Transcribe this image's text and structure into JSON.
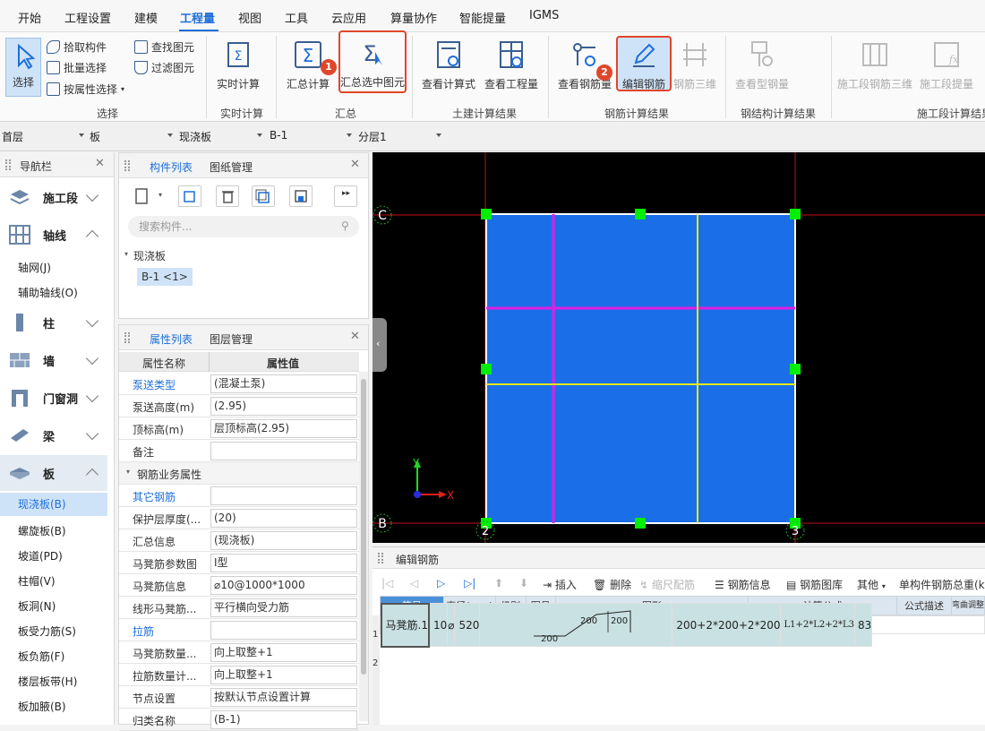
{
  "menu": [
    "开始",
    "工程设置",
    "建模",
    "工程量",
    "视图",
    "工具",
    "云应用",
    "算量协作",
    "智能提量",
    "IGMS"
  ],
  "ribbon": {
    "select_group": {
      "select": "选择",
      "pick": "拾取构件",
      "batch": "批量选择",
      "by_attr": "按属性选择",
      "find": "查找图元",
      "filter": "过滤图元",
      "label": "选择"
    },
    "realtime": {
      "btn": "实时计算",
      "label": "实时计算"
    },
    "summary": {
      "calc": "汇总计算",
      "calc_selected": "汇总选中图元",
      "label": "汇总"
    },
    "civil": {
      "formula": "查看计算式",
      "quantity": "查看工程量",
      "label": "土建计算结果"
    },
    "rebar": {
      "view": "查看钢筋量",
      "edit": "编辑钢筋",
      "three_d": "钢筋三维",
      "label": "钢筋计算结果"
    },
    "steel": {
      "view": "查看型钢量",
      "label": "钢结构计算结果"
    },
    "construction": {
      "three_d": "施工段钢筋三维",
      "lift": "施工段提量",
      "label": "施工段计算结果"
    },
    "badges": [
      "1",
      "2"
    ]
  },
  "selectors": [
    "首层",
    "板",
    "现浇板",
    "B-1",
    "分层1"
  ],
  "nav": {
    "title": "导航栏",
    "categories": {
      "shigongduan": "施工段",
      "axis": "轴线",
      "column": "柱",
      "wall": "墙",
      "door": "门窗洞",
      "beam": "梁",
      "slab": "板"
    },
    "axis_items": [
      "轴网(J)",
      "辅助轴线(O)"
    ],
    "slab_items": [
      "现浇板(B)",
      "螺旋板(B)",
      "坡道(PD)",
      "柱帽(V)",
      "板洞(N)",
      "板受力筋(S)",
      "板负筋(F)",
      "楼层板带(H)",
      "板加腋(B)"
    ]
  },
  "component": {
    "tab_list": "构件列表",
    "tab_drawing": "图纸管理",
    "search_placeholder": "搜索构件...",
    "tree_root": "现浇板",
    "tree_item": "B-1 <1>"
  },
  "properties": {
    "tab_list": "属性列表",
    "tab_layer": "图层管理",
    "col_name": "属性名称",
    "col_value": "属性值",
    "section_rebar": "钢筋业务属性",
    "rows": [
      {
        "name": "泵送类型",
        "value": "(混凝土泵)",
        "link": true
      },
      {
        "name": "泵送高度(m)",
        "value": "(2.95)",
        "link": false
      },
      {
        "name": "顶标高(m)",
        "value": "层顶标高(2.95)",
        "link": false
      },
      {
        "name": "备注",
        "value": "",
        "link": false
      }
    ],
    "rebar_rows": [
      {
        "name": "其它钢筋",
        "value": "",
        "link": true
      },
      {
        "name": "保护层厚度(...",
        "value": "(20)",
        "link": false
      },
      {
        "name": "汇总信息",
        "value": "(现浇板)",
        "link": false
      },
      {
        "name": "马凳筋参数图",
        "value": "Ⅰ型",
        "link": false
      },
      {
        "name": "马凳筋信息",
        "value": "⌀10@1000*1000",
        "link": false
      },
      {
        "name": "线形马凳筋...",
        "value": "平行横向受力筋",
        "link": false
      },
      {
        "name": "拉筋",
        "value": "",
        "link": true
      },
      {
        "name": "马凳筋数量...",
        "value": "向上取整+1",
        "link": false
      },
      {
        "name": "拉筋数量计...",
        "value": "向上取整+1",
        "link": false
      },
      {
        "name": "节点设置",
        "value": "按默认节点设置计算",
        "link": false
      },
      {
        "name": "归类名称",
        "value": "(B-1)",
        "link": false
      }
    ]
  },
  "canvas": {
    "axis_labels": [
      "C",
      "B",
      "2",
      "3"
    ],
    "coord_x": "X",
    "coord_y": "Y"
  },
  "editor": {
    "title": "编辑钢筋",
    "tools": {
      "insert": "插入",
      "delete": "删除",
      "scale": "缩尺配筋",
      "info": "钢筋信息",
      "lib": "钢筋图库",
      "other": "其他",
      "total": "单构件钢筋总重(k"
    },
    "columns": [
      "筋号",
      "直径(mm)",
      "级别",
      "图号",
      "图形",
      "计算公式",
      "公式描述",
      "弯曲调整"
    ],
    "rows": [
      {
        "idx": "1",
        "name": "马凳筋.1",
        "dia": "10",
        "grade": "⌀",
        "fig": "520",
        "formula": "200+2*200+2*200",
        "desc": "L1+2*L2+2*L3",
        "bend": "83",
        "shape_labels": [
          "200",
          "200",
          "200"
        ]
      },
      {
        "idx": "2"
      }
    ]
  },
  "colors": {
    "accent": "#1e6fd9",
    "highlight": "#e0462b",
    "slab": "#1a6fe8",
    "grip": "#00ff00"
  }
}
